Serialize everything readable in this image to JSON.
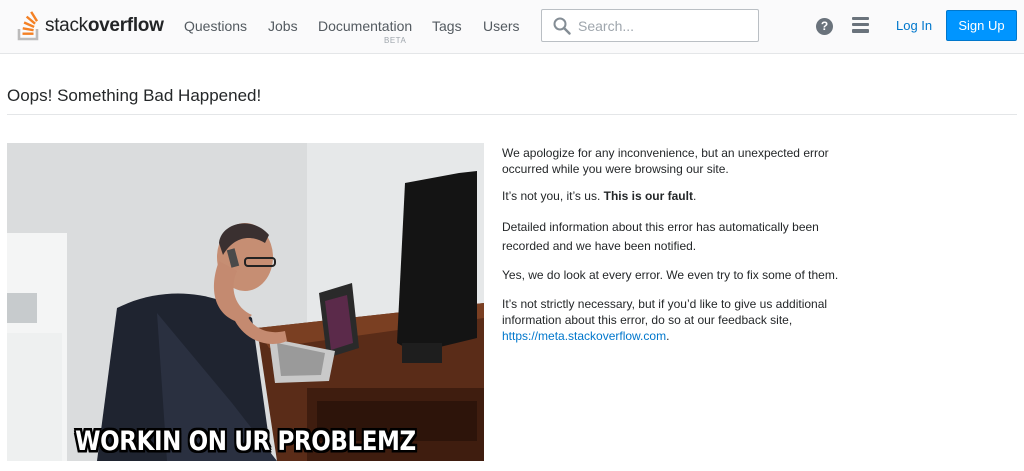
{
  "header": {
    "logo": {
      "text_light": "stack",
      "text_bold": "overflow"
    },
    "nav": [
      {
        "label": "Questions"
      },
      {
        "label": "Jobs"
      },
      {
        "label": "Documentation",
        "badge": "BETA"
      },
      {
        "label": "Tags"
      },
      {
        "label": "Users"
      }
    ],
    "search": {
      "placeholder": "Search..."
    },
    "help_icon_glyph": "?",
    "login_label": "Log In",
    "signup_label": "Sign Up"
  },
  "main": {
    "title": "Oops! Something Bad Happened!",
    "image_caption": "WORKIN ON UR PROBLEMZ",
    "paragraphs": {
      "p1": "We apologize for any inconvenience, but an unexpected error occurred while you were browsing our site.",
      "p2_prefix": "It’s not you, it’s us. ",
      "p2_bold": "This is our fault",
      "p2_suffix": ".",
      "p3": "Detailed information about this error has automatically been recorded and we have been notified.",
      "p4": "Yes, we do look at every error. We even try to fix some of them.",
      "p5": "It’s not strictly necessary, but if you’d like to give us additional information about this error, do so at our feedback site,",
      "p5_link": "https://meta.stackoverflow.com",
      "p5_end": "."
    }
  },
  "colors": {
    "accent": "#0095ff",
    "link": "#0077cc",
    "logo_orange": "#f48024"
  }
}
